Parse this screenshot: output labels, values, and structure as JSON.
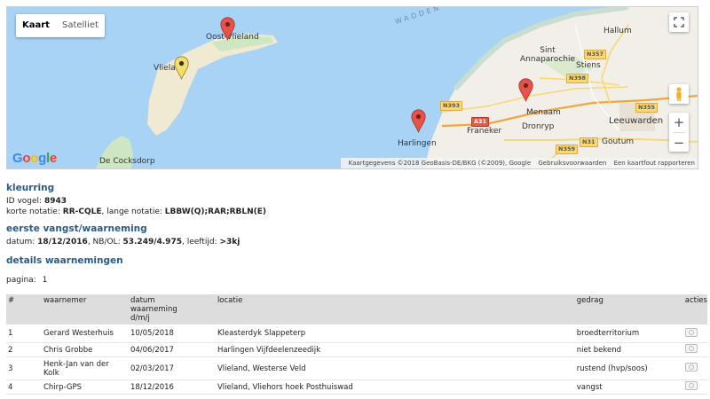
{
  "map": {
    "map_type_buttons": [
      "Kaart",
      "Satelliet"
    ],
    "active_map_type": "Kaart",
    "place_labels": {
      "oost_vlieland": "Oost-Vlieland",
      "vlieland": "Vlieland",
      "de_cocksdorp": "De Cocksdorp",
      "hallum": "Hallum",
      "sint_annaparochie": "Sint\nAnnaparochie",
      "stiens": "Stiens",
      "menaam": "Menaam",
      "leeuwarden": "Leeuwarden",
      "harlingen": "Harlingen",
      "franeker": "Franeker",
      "dronryp": "Dronryp",
      "goutum": "Goutum",
      "wadden": "WADDEN"
    },
    "road_shields": [
      "N357",
      "N398",
      "N393",
      "A31",
      "N355",
      "N31",
      "N359"
    ],
    "zoom_in": "+",
    "zoom_out": "−",
    "brand": "Google",
    "attribution": {
      "data": "Kaartgegevens ©2018 GeoBasis-DE/BKG (©2009), Google",
      "terms": "Gebruiksvoorwaarden",
      "report": "Een kaartfout rapporteren"
    },
    "marker_colors": {
      "red": "#e5534b",
      "yellow": "#f3e06a"
    }
  },
  "kleurring": {
    "title": "kleurring",
    "id_label": "ID vogel:",
    "id_value": "8943",
    "short_label": "korte notatie:",
    "short_value": "RR-CQLE",
    "long_label": ", lange notatie:",
    "long_value": "LBBW(Q);RAR;RBLN(E)"
  },
  "first_catch": {
    "title": "eerste vangst/waarneming",
    "date_label": "datum:",
    "date_value": "18/12/2016",
    "coords_label": ", NB/OL:",
    "coords_value": "53.249/4.975",
    "age_label": ", leeftijd:",
    "age_value": ">3kj"
  },
  "details": {
    "title": "details waarnemingen",
    "page_label": "pagina:",
    "page_value": "1"
  },
  "table": {
    "headers": {
      "num": "#",
      "observer": "waarnemer",
      "date": "datum\nwaarneming\nd/m/j",
      "location": "locatie",
      "behaviour": "gedrag",
      "actions": "acties"
    },
    "rows": [
      {
        "num": "1",
        "observer": "Gerard Westerhuis",
        "date": "10/05/2018",
        "location": "Kleasterdyk Slappeterp",
        "behaviour": "broedterritorium"
      },
      {
        "num": "2",
        "observer": "Chris Grobbe",
        "date": "04/06/2017",
        "location": "Harlingen Vijfdeelenzeedijk",
        "behaviour": "niet bekend"
      },
      {
        "num": "3",
        "observer": "Henk-Jan van der\nKolk",
        "date": "02/03/2017",
        "location": "Vlieland, Westerse Veld",
        "behaviour": "rustend (hvp/soos)"
      },
      {
        "num": "4",
        "observer": "Chirp-GPS",
        "date": "18/12/2016",
        "location": "Vlieland, Vliehors hoek Posthuiswad",
        "behaviour": "vangst"
      }
    ],
    "action_icon": "camera-icon"
  }
}
